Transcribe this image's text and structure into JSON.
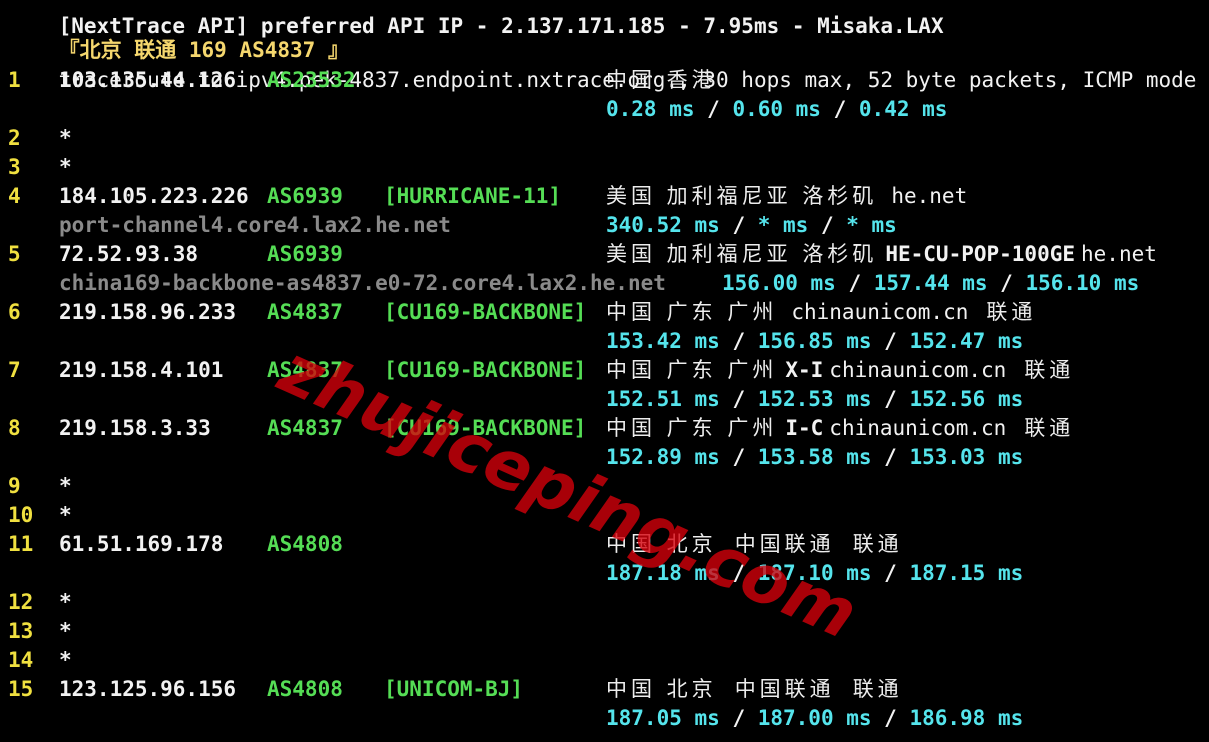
{
  "header": {
    "top_cut_line": "[NextTrace API] preferred API IP - 2.137.171.185 - 7.95ms - Misaka.LAX",
    "destination_tag": "『北京 联通 169 AS4837 』",
    "traceroute_info": "traceroute to ipv4.pek-4837.endpoint.nxtrace.org., 30 hops max, 52 byte packets, ICMP mode"
  },
  "hops": [
    {
      "num": "1",
      "ip": "103.135.44.126",
      "asn": "AS23532",
      "tag": "",
      "geo": "中国 香港",
      "host": "",
      "rdns": "",
      "rtt": [
        "0.28 ms",
        "0.60 ms",
        "0.42 ms"
      ]
    },
    {
      "num": "2",
      "ip": "*"
    },
    {
      "num": "3",
      "ip": "*"
    },
    {
      "num": "4",
      "ip": "184.105.223.226",
      "asn": "AS6939",
      "tag": "[HURRICANE-11]",
      "geo": "美国 加利福尼亚 洛杉矶",
      "host": "he.net",
      "rdns": "port-channel4.core4.lax2.he.net",
      "rtt": [
        "340.52 ms",
        "* ms",
        "* ms"
      ]
    },
    {
      "num": "5",
      "ip": "72.52.93.38",
      "asn": "AS6939",
      "tag": "",
      "geo": "美国 加利福尼亚 洛杉矶",
      "host_bold": "HE-CU-POP-100GE",
      "host": "he.net",
      "rdns": "china169-backbone-as4837.e0-72.core4.lax2.he.net",
      "rtt": [
        "156.00 ms",
        "157.44 ms",
        "156.10 ms"
      ]
    },
    {
      "num": "6",
      "ip": "219.158.96.233",
      "asn": "AS4837",
      "tag": "[CU169-BACKBONE]",
      "geo": "中国 广东 广州",
      "host": "chinaunicom.cn",
      "isp": "联通",
      "rtt": [
        "153.42 ms",
        "156.85 ms",
        "152.47 ms"
      ]
    },
    {
      "num": "7",
      "ip": "219.158.4.101",
      "asn": "AS4837",
      "tag": "[CU169-BACKBONE]",
      "geo": "中国 广东 广州",
      "host_bold": "X-I",
      "host": "chinaunicom.cn",
      "isp": "联通",
      "rtt": [
        "152.51 ms",
        "152.53 ms",
        "152.56 ms"
      ]
    },
    {
      "num": "8",
      "ip": "219.158.3.33",
      "asn": "AS4837",
      "tag": "[CU169-BACKBONE]",
      "geo": "中国 广东 广州",
      "host_bold": "I-C",
      "host": "chinaunicom.cn",
      "isp": "联通",
      "rtt": [
        "152.89 ms",
        "153.58 ms",
        "153.03 ms"
      ]
    },
    {
      "num": "9",
      "ip": "*"
    },
    {
      "num": "10",
      "ip": "*"
    },
    {
      "num": "11",
      "ip": "61.51.169.178",
      "asn": "AS4808",
      "tag": "",
      "geo": "中国 北京",
      "org": "中国联通",
      "isp": "联通",
      "rtt": [
        "187.18 ms",
        "187.10 ms",
        "187.15 ms"
      ]
    },
    {
      "num": "12",
      "ip": "*"
    },
    {
      "num": "13",
      "ip": "*"
    },
    {
      "num": "14",
      "ip": "*"
    },
    {
      "num": "15",
      "ip": "123.125.96.156",
      "asn": "AS4808",
      "tag": "[UNICOM-BJ]",
      "geo": "中国 北京",
      "org": "中国联通",
      "isp": "联通",
      "rtt": [
        "187.05 ms",
        "187.00 ms",
        "186.98 ms"
      ]
    }
  ],
  "separator": " / ",
  "watermark": "zhujiceping.com",
  "colors": {
    "background": "#000000",
    "hop_number": "#f0e040",
    "ip": "#f2f2f2",
    "asn": "#55dd55",
    "rtt": "#55e4ec",
    "rdns": "#8a8a8a",
    "watermark": "#d7000a"
  }
}
